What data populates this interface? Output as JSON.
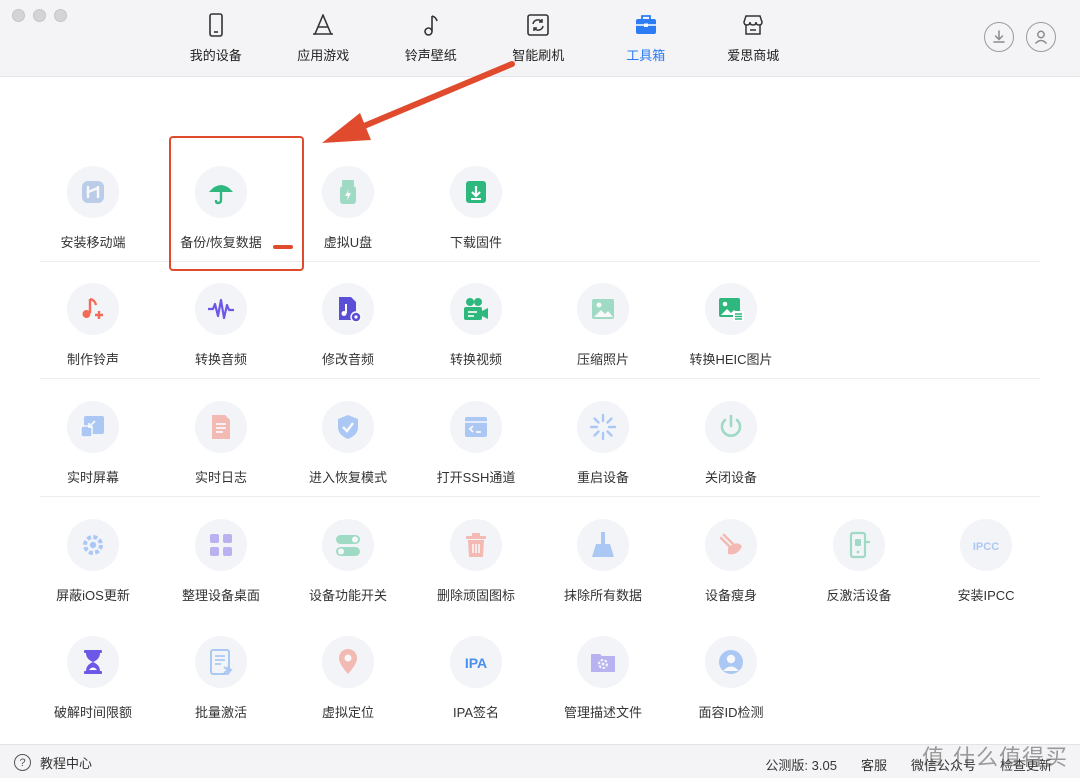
{
  "nav": {
    "items": [
      {
        "label": "我的设备",
        "icon": "phone-icon"
      },
      {
        "label": "应用游戏",
        "icon": "app-store-icon"
      },
      {
        "label": "铃声壁纸",
        "icon": "music-note-icon"
      },
      {
        "label": "智能刷机",
        "icon": "refresh-box-icon"
      },
      {
        "label": "工具箱",
        "icon": "toolbox-icon",
        "active": true
      },
      {
        "label": "爱思商城",
        "icon": "store-icon"
      }
    ],
    "active_color": "#2b7cf6"
  },
  "top_right": {
    "download_icon": "download-icon",
    "user_icon": "user-icon"
  },
  "tools": {
    "row1": [
      {
        "label": "安装移动端",
        "icon": "install-mobile-icon",
        "color": "#8fb0d8"
      },
      {
        "label": "备份/恢复数据",
        "icon": "umbrella-icon",
        "color": "#2eb87e"
      },
      {
        "label": "虚拟U盘",
        "icon": "usb-drive-icon",
        "color": "#7ed4a6"
      },
      {
        "label": "下载固件",
        "icon": "download-firmware-icon",
        "color": "#2eb87e"
      }
    ],
    "row2": [
      {
        "label": "制作铃声",
        "icon": "ringtone-icon",
        "color": "#f26b56"
      },
      {
        "label": "转换音频",
        "icon": "audio-wave-icon",
        "color": "#6b58e6"
      },
      {
        "label": "修改音频",
        "icon": "audio-file-icon",
        "color": "#5a4fd6"
      },
      {
        "label": "转换视频",
        "icon": "video-camera-icon",
        "color": "#2eb87e"
      },
      {
        "label": "压缩照片",
        "icon": "photo-icon",
        "color": "#7ed4a6"
      },
      {
        "label": "转换HEIC图片",
        "icon": "heic-image-icon",
        "color": "#2eb87e"
      }
    ],
    "row3": [
      {
        "label": "实时屏幕",
        "icon": "screen-icon",
        "color": "#4a8ef0"
      },
      {
        "label": "实时日志",
        "icon": "log-icon",
        "color": "#f26b56"
      },
      {
        "label": "进入恢复模式",
        "icon": "shield-check-icon",
        "color": "#4a8ef0"
      },
      {
        "label": "打开SSH通道",
        "icon": "terminal-icon",
        "color": "#4a8ef0"
      },
      {
        "label": "重启设备",
        "icon": "restart-spinner-icon",
        "color": "#4a8ef0"
      },
      {
        "label": "关闭设备",
        "icon": "power-icon",
        "color": "#2eb87e"
      }
    ],
    "row4": [
      {
        "label": "屏蔽iOS更新",
        "icon": "gear-icon",
        "color": "#4a8ef0"
      },
      {
        "label": "整理设备桌面",
        "icon": "grid-icon",
        "color": "#6b58e6"
      },
      {
        "label": "设备功能开关",
        "icon": "toggle-icon",
        "color": "#2eb87e"
      },
      {
        "label": "删除顽固图标",
        "icon": "trash-icon",
        "color": "#f26b56"
      },
      {
        "label": "抹除所有数据",
        "icon": "broom-icon",
        "color": "#4a8ef0"
      },
      {
        "label": "设备瘦身",
        "icon": "slim-icon",
        "color": "#f26b56"
      },
      {
        "label": "反激活设备",
        "icon": "deactivate-phone-icon",
        "color": "#2eb87e"
      },
      {
        "label": "安装IPCC",
        "icon": "ipcc-icon",
        "color": "#4a8ef0",
        "text_glyph": "IPCC"
      }
    ],
    "row5": [
      {
        "label": "破解时间限额",
        "icon": "hourglass-icon",
        "color": "#6b58e6"
      },
      {
        "label": "批量激活",
        "icon": "batch-activate-icon",
        "color": "#4a8ef0"
      },
      {
        "label": "虚拟定位",
        "icon": "location-pin-icon",
        "color": "#f26b56"
      },
      {
        "label": "IPA签名",
        "icon": "ipa-icon",
        "color": "#4a8ef0",
        "text_glyph": "IPA"
      },
      {
        "label": "管理描述文件",
        "icon": "profile-folder-icon",
        "color": "#6b58e6"
      },
      {
        "label": "面容ID检测",
        "icon": "face-id-icon",
        "color": "#4a8ef0"
      }
    ]
  },
  "footer": {
    "help_label": "教程中心",
    "help_icon": "question-icon",
    "version": "公测版: 3.05",
    "service": "客服",
    "wechat": "微信公众号",
    "update": "检查更新"
  },
  "watermark": "值 什么值得买",
  "annotation_color": "#e04b2e"
}
